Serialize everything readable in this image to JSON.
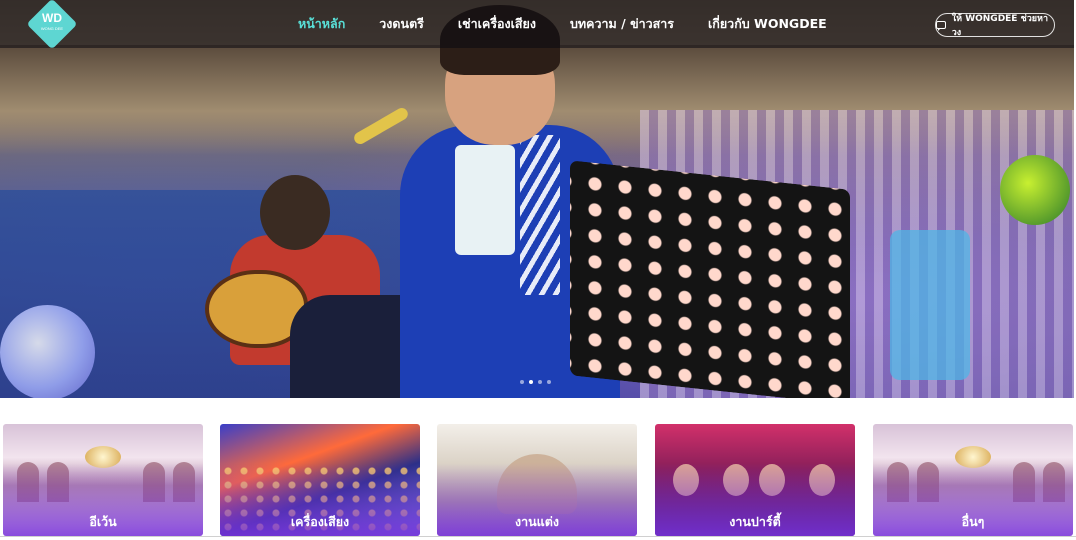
{
  "brand": {
    "logo_text": "WD",
    "logo_subtitle": "WONG DEE"
  },
  "nav": {
    "items": [
      {
        "label": "หน้าหลัก",
        "active": true
      },
      {
        "label": "วงดนตรี",
        "active": false
      },
      {
        "label": "เช่าเครื่องเสียง",
        "active": false
      },
      {
        "label": "บทความ / ข่าวสาร",
        "active": false
      },
      {
        "label": "เกี่ยวกับ WONGDEE",
        "active": false
      }
    ],
    "cta_label": "ให้ WONGDEE ช่วยหาวง",
    "cta_icon": "chat-icon"
  },
  "hero": {
    "slide_count": 4,
    "active_slide": 2
  },
  "categories": [
    {
      "label": "อีเว้น"
    },
    {
      "label": "เครื่องเสียง"
    },
    {
      "label": "งานแต่ง"
    },
    {
      "label": "งานปาร์ตี้"
    },
    {
      "label": "อื่นๆ"
    }
  ],
  "colors": {
    "accent": "#59e0d8",
    "card_overlay": "#7832dc"
  }
}
